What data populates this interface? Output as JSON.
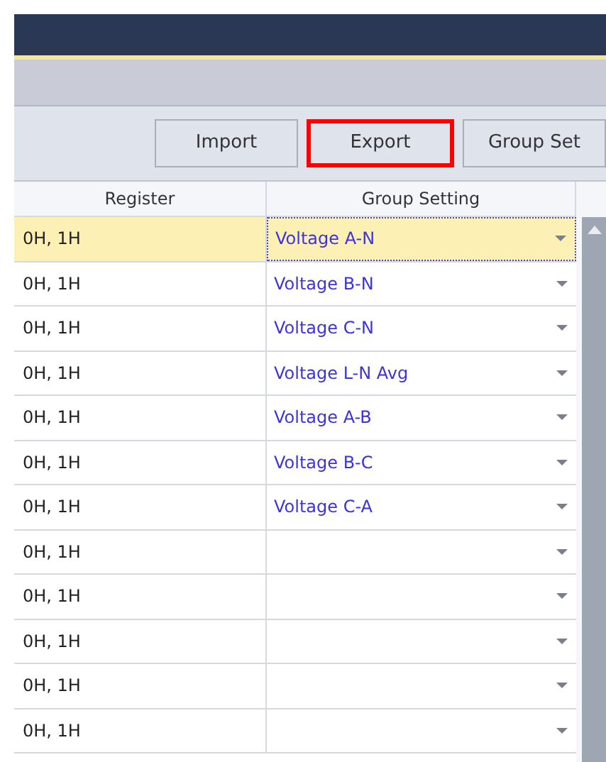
{
  "toolbar": {
    "buttons": [
      {
        "label": "Import",
        "highlighted": false
      },
      {
        "label": "Export",
        "highlighted": true
      },
      {
        "label": "Group Set",
        "highlighted": false
      }
    ]
  },
  "table": {
    "columns": [
      "Register",
      "Group Setting"
    ],
    "rows": [
      {
        "register": "0H, 1H",
        "group": "Voltage A-N",
        "selected": true
      },
      {
        "register": "0H, 1H",
        "group": "Voltage B-N",
        "selected": false
      },
      {
        "register": "0H, 1H",
        "group": "Voltage C-N",
        "selected": false
      },
      {
        "register": "0H, 1H",
        "group": "Voltage L-N Avg",
        "selected": false
      },
      {
        "register": "0H, 1H",
        "group": "Voltage A-B",
        "selected": false
      },
      {
        "register": "0H, 1H",
        "group": "Voltage B-C",
        "selected": false
      },
      {
        "register": "0H, 1H",
        "group": "Voltage C-A",
        "selected": false
      },
      {
        "register": "0H, 1H",
        "selected": false
      },
      {
        "register": "0H, 1H",
        "selected": false
      },
      {
        "register": "0H, 1H",
        "selected": false
      },
      {
        "register": "0H, 1H",
        "selected": false
      },
      {
        "register": "0H, 1H",
        "selected": false
      }
    ]
  }
}
